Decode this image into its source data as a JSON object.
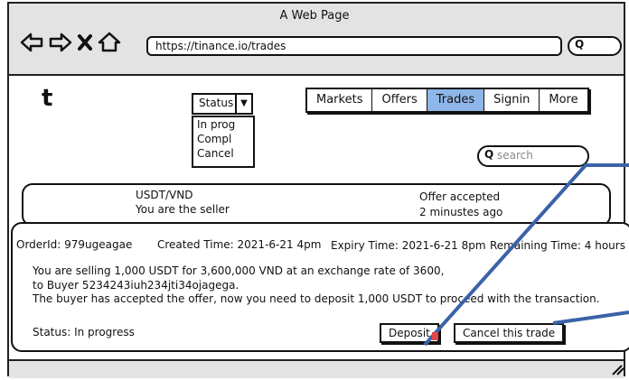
{
  "browser": {
    "window_title": "A Web Page",
    "url": "https://tinance.io/trades",
    "icons": [
      "back-arrow",
      "forward-arrow",
      "close-x",
      "home"
    ]
  },
  "header": {
    "logo": "t",
    "status_select": {
      "selected": "Status",
      "options": [
        "In prog",
        "Compl",
        "Cancel"
      ]
    },
    "menu": {
      "tabs": [
        "Markets",
        "Offers",
        "Trades",
        "Signin",
        "More"
      ],
      "active": "Trades",
      "active_color": "#8fb6e8"
    },
    "search_placeholder": "search"
  },
  "trade": {
    "pair": "USDT/VND",
    "role": "You are the seller",
    "state": "Offer accepted",
    "time_ago": "2 minustes ago",
    "order_id": "OrderId: 979ugeagae",
    "created": "Created Time: 2021-6-21 4pm",
    "expiry": "Expiry Time: 2021-6-21 8pm",
    "remaining": "Remaining Time: 4 hours",
    "line1": "You are selling 1,000 USDT for 3,600,000 VND at an exchange rate of 3600,",
    "line2": "to Buyer 5234243iuh234jti34ojagega.",
    "line3": "The buyer has accepted the offer, now you need to deposit 1,000 USDT to proceed with the transaction.",
    "status": "Status: In progress",
    "deposit_label": "Deposit",
    "cancel_label": "Cancel this trade"
  },
  "annotation_color": "#3a63a8"
}
